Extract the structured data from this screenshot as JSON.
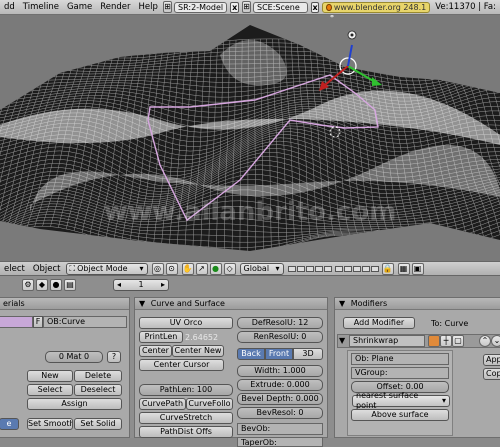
{
  "topbar": {
    "menu": [
      "dd",
      "Timeline",
      "Game",
      "Render",
      "Help"
    ],
    "screen_field": "SR:2-Model",
    "scene_field": "SCE:Scene",
    "url": "www.blender.org 248.1",
    "stats": "Ve:11370 | Fa:"
  },
  "viewport": {
    "watermark": "www.allanbrito.com"
  },
  "view3d_header": {
    "select_menu": "elect",
    "object_menu": "Object",
    "mode": "Object Mode",
    "orientation": "Global"
  },
  "buttons_toolbar": {
    "frame": "1"
  },
  "materials_panel": {
    "title": "erials",
    "f_label": "F",
    "ob_field": "OB:Curve",
    "mat_index": "0 Mat 0",
    "question": "?",
    "new": "New",
    "delete": "Delete",
    "select": "Select",
    "deselect": "Deselect",
    "assign": "Assign",
    "partial": "e",
    "set_smooth": "Set Smooth",
    "set_solid": "Set Solid"
  },
  "curve_panel": {
    "title": "Curve and Surface",
    "uv_orco": "UV Orco",
    "print_len": "PrintLen",
    "len_value": "2.64652",
    "center": "Center",
    "center_new": "Center New",
    "center_cursor": "Center Cursor",
    "path_len": "PathLen: 100",
    "curve_path": "CurvePath",
    "curve_follow": "CurveFollo",
    "curve_stretch": "CurveStretch",
    "path_dist": "PathDist Offs",
    "def_resol": "DefResolU: 12",
    "ren_resol": "RenResolU: 0",
    "back": "Back",
    "front": "Front",
    "three_d": "3D",
    "width": "Width: 1.000",
    "extrude": "Extrude: 0.000",
    "bevel_depth": "Bevel Depth: 0.000",
    "bev_resol": "BevResol: 0",
    "bev_ob": "BevOb:",
    "taper_ob": "TaperOb:"
  },
  "modifiers_panel": {
    "title": "Modifiers",
    "add_modifier": "Add Modifier",
    "to_label": "To: Curve",
    "modifier_name": "Shrinkwrap",
    "ob_field": "Ob: Plane",
    "vgroup": "VGroup:",
    "offset": "Offset: 0.00",
    "mode": "nearest surface point",
    "above_surface": "Above surface",
    "apply": "App",
    "copy": "Cop"
  }
}
